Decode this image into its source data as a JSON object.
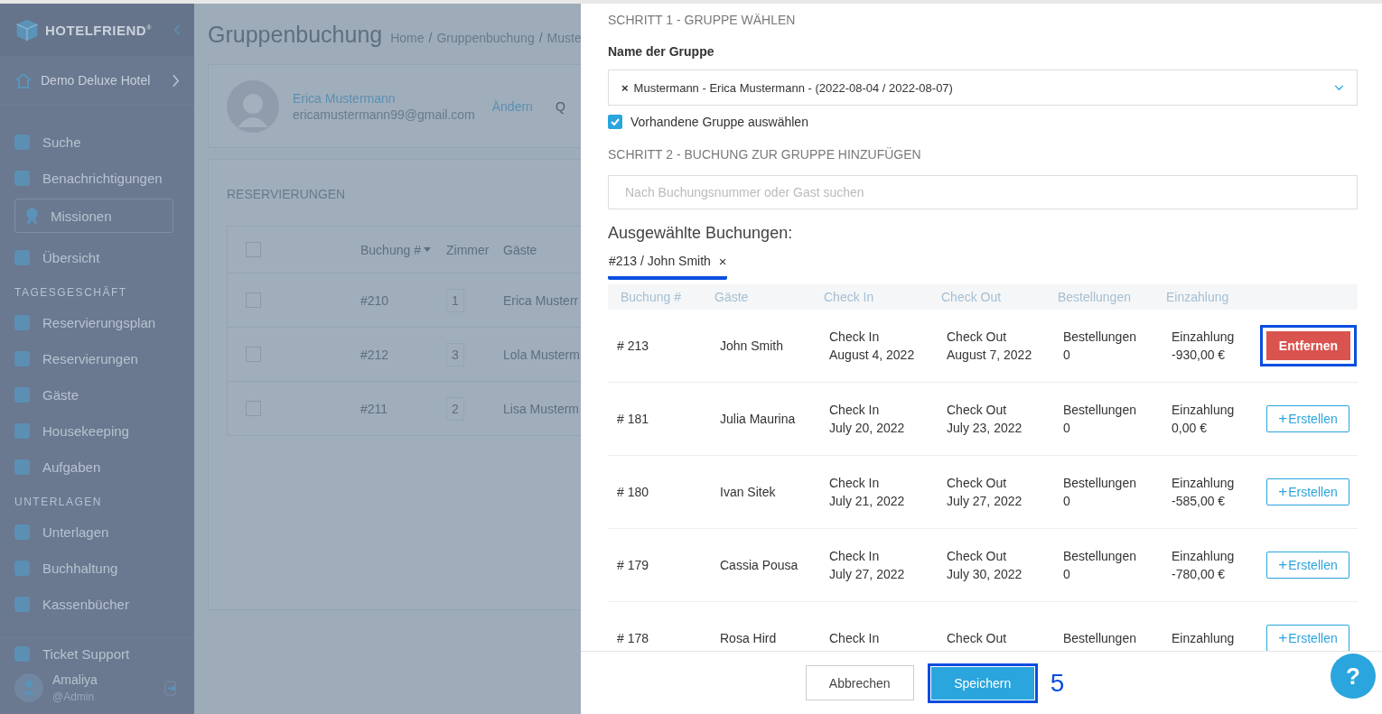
{
  "sidebar": {
    "logo": "HOTELFRIEND",
    "logo_mark": "®",
    "hotel": "Demo Deluxe Hotel",
    "items": [
      {
        "kind": "item",
        "label": "Suche"
      },
      {
        "kind": "item",
        "label": "Benachrichtigungen"
      },
      {
        "kind": "boxed",
        "label": "Missionen"
      },
      {
        "kind": "item",
        "label": "Übersicht"
      },
      {
        "kind": "section",
        "label": "TAGESGESCHÄFT"
      },
      {
        "kind": "item",
        "label": "Reservierungsplan"
      },
      {
        "kind": "item",
        "label": "Reservierungen"
      },
      {
        "kind": "item",
        "label": "Gäste"
      },
      {
        "kind": "item",
        "label": "Housekeeping"
      },
      {
        "kind": "item",
        "label": "Aufgaben"
      },
      {
        "kind": "section",
        "label": "UNTERLAGEN"
      },
      {
        "kind": "item",
        "label": "Unterlagen"
      },
      {
        "kind": "item",
        "label": "Buchhaltung"
      },
      {
        "kind": "item",
        "label": "Kassenbücher"
      }
    ],
    "support": "Ticket Support",
    "user": {
      "name": "Amaliya",
      "role": "@Admin"
    }
  },
  "page": {
    "title": "Gruppenbuchung",
    "breadcrumb": [
      "Home",
      "Gruppenbuchung",
      "Muste"
    ],
    "breadcrumb_separator": "/",
    "customer": {
      "name": "Erica Mustermann",
      "email": "ericamustermann99@gmail.com",
      "edit": "Ändern",
      "cut": "Q"
    },
    "reservations": {
      "title": "RESERVIERUNGEN",
      "columns": [
        "Buchung #",
        "Zimmer",
        "Gäste"
      ],
      "all_checked": false,
      "rows": [
        {
          "number": "#210",
          "room": "1",
          "guest": "Erica Musterr",
          "checked": false
        },
        {
          "number": "#212",
          "room": "3",
          "guest": "Lola Musterm",
          "checked": false
        },
        {
          "number": "#211",
          "room": "2",
          "guest": "Lisa Musterm",
          "checked": false
        }
      ]
    }
  },
  "modal": {
    "step1": "SCHRITT 1 - GRUPPE WÄHLEN",
    "group_label": "Name der Gruppe",
    "group_value": "Mustermann - Erica Mustermann - (2022-08-04 / 2022-08-07)",
    "group_clear": "×",
    "existing": {
      "label": "Vorhandene Gruppe auswählen",
      "checked": true
    },
    "step2": "SCHRITT 2 - BUCHUNG ZUR GRUPPE HINZUFÜGEN",
    "search": {
      "placeholder": "Nach Buchungsnummer oder Gast suchen"
    },
    "selected_title": "Ausgewählte Buchungen:",
    "selected": [
      {
        "label": "#213 / John Smith",
        "remove": "×",
        "underlined": true
      }
    ],
    "columns": [
      "Buchung #",
      "Gäste",
      "Check In",
      "Check Out",
      "Bestellungen",
      "Einzahlung"
    ],
    "rows": [
      {
        "number": "# 213",
        "guest": "John Smith",
        "checkin": [
          "Check In",
          "August 4, 2022"
        ],
        "checkout": [
          "Check Out",
          "August 7, 2022"
        ],
        "orders": [
          "Bestellungen",
          "0"
        ],
        "deposit": [
          "Einzahlung",
          "-930,00 €"
        ],
        "action": {
          "kind": "remove",
          "label": "Entfernen",
          "highlighted": true
        }
      },
      {
        "number": "# 181",
        "guest": "Julia Maurina",
        "checkin": [
          "Check In",
          "July 20, 2022"
        ],
        "checkout": [
          "Check Out",
          "July 23, 2022"
        ],
        "orders": [
          "Bestellungen",
          "0"
        ],
        "deposit": [
          "Einzahlung",
          "0,00 €"
        ],
        "action": {
          "kind": "create",
          "icon": "+",
          "label": "Erstellen",
          "highlighted": false
        }
      },
      {
        "number": "# 180",
        "guest": "Ivan Sitek",
        "checkin": [
          "Check In",
          "July 21, 2022"
        ],
        "checkout": [
          "Check Out",
          "July 27, 2022"
        ],
        "orders": [
          "Bestellungen",
          "0"
        ],
        "deposit": [
          "Einzahlung",
          "-585,00 €"
        ],
        "action": {
          "kind": "create",
          "icon": "+",
          "label": "Erstellen",
          "highlighted": false
        }
      },
      {
        "number": "# 179",
        "guest": "Cassia Pousa",
        "checkin": [
          "Check In",
          "July 27, 2022"
        ],
        "checkout": [
          "Check Out",
          "July 30, 2022"
        ],
        "orders": [
          "Bestellungen",
          "0"
        ],
        "deposit": [
          "Einzahlung",
          "-780,00 €"
        ],
        "action": {
          "kind": "create",
          "icon": "+",
          "label": "Erstellen",
          "highlighted": false
        }
      },
      {
        "number": "# 178",
        "guest": "Rosa Hird",
        "checkin": [
          "Check In"
        ],
        "checkout": [
          "Check Out"
        ],
        "orders": [
          "Bestellungen"
        ],
        "deposit": [
          "Einzahlung"
        ],
        "action": {
          "kind": "create",
          "icon": "+",
          "label": "Erstellen",
          "highlighted": false
        }
      }
    ],
    "footer": {
      "cancel": {
        "label": "Abbrechen",
        "highlighted": false
      },
      "save": {
        "label": "Speichern",
        "highlighted": true
      },
      "step": "5"
    },
    "help": "?"
  }
}
